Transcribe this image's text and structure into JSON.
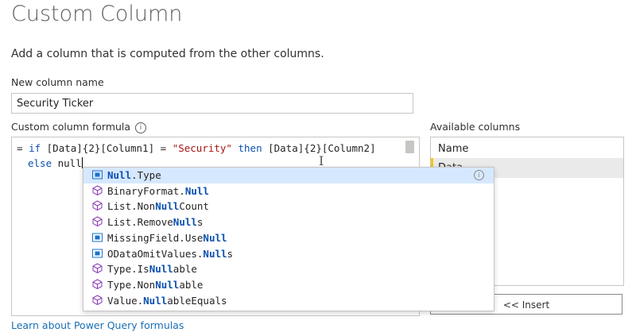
{
  "dialog": {
    "title": "Custom Column",
    "subtitle": "Add a column that is computed from the other columns.",
    "new_column_label": "New column name",
    "new_column_value": "Security Ticker",
    "formula_label": "Custom column formula",
    "formula": {
      "line1": {
        "p1": "= ",
        "kw1": "if",
        "p2": " [Data]{2}[Column1] = ",
        "str": "\"Security\"",
        "p3": " ",
        "kw2": "then",
        "p4": " [Data]{2}[Column2]"
      },
      "line2": {
        "kw": "else",
        "p": " null"
      }
    },
    "available_label": "Available columns",
    "available_columns": [
      {
        "label": "Name"
      },
      {
        "label": "Data"
      }
    ],
    "insert_label": "<< Insert",
    "learn_link": "Learn about Power Query formulas"
  },
  "suggestions": [
    {
      "icon": "field-icon",
      "before": "",
      "match": "Null",
      "after": ".Type"
    },
    {
      "icon": "function-icon",
      "before": "BinaryFormat.",
      "match": "Null",
      "after": ""
    },
    {
      "icon": "function-icon",
      "before": "List.Non",
      "match": "Null",
      "after": "Count"
    },
    {
      "icon": "function-icon",
      "before": "List.Remove",
      "match": "Null",
      "after": "s"
    },
    {
      "icon": "field-icon",
      "before": "MissingField.Use",
      "match": "Null",
      "after": ""
    },
    {
      "icon": "field-icon",
      "before": "ODataOmitValues.",
      "match": "Null",
      "after": "s"
    },
    {
      "icon": "function-icon",
      "before": "Type.Is",
      "match": "Null",
      "after": "able"
    },
    {
      "icon": "function-icon",
      "before": "Type.Non",
      "match": "Null",
      "after": "able"
    },
    {
      "icon": "function-icon",
      "before": "Value.",
      "match": "Null",
      "after": "ableEquals"
    }
  ],
  "colors": {
    "accent": "#0a4fb0",
    "selection": "#d6e8ff",
    "highlight_bar": "#f2c811",
    "link": "#1a6fb5"
  }
}
